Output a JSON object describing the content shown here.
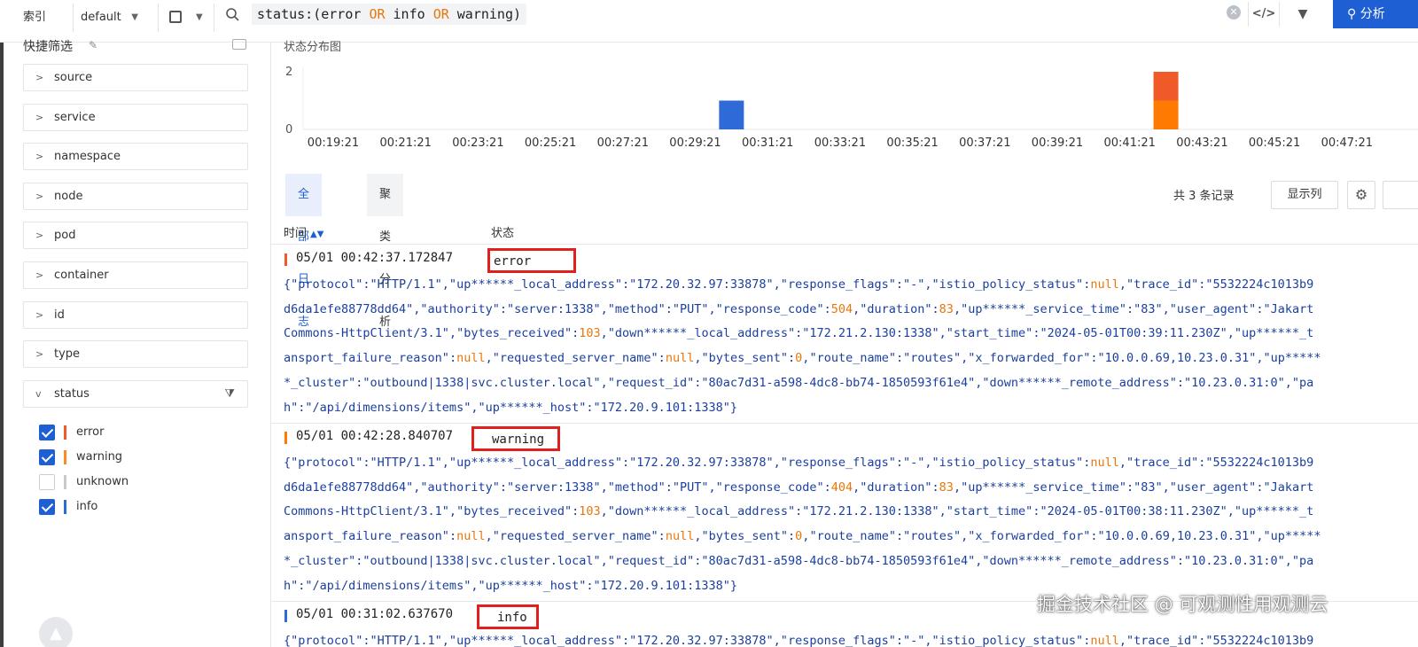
{
  "topbar": {
    "index_label": "索引",
    "index_value": "default",
    "query_prefix": "status:(",
    "query_tokens": [
      "error",
      "OR",
      "info",
      "OR",
      "warning"
    ],
    "query_suffix": ")",
    "analyze_label": "分析"
  },
  "sidebar": {
    "title": "快捷筛选",
    "fields": [
      "source",
      "service",
      "namespace",
      "node",
      "pod",
      "container",
      "id",
      "type"
    ],
    "status_field": "status",
    "status_options": [
      {
        "label": "error",
        "checked": true,
        "color": "#f05a28"
      },
      {
        "label": "warning",
        "checked": true,
        "color": "#ff8a1f"
      },
      {
        "label": "unknown",
        "checked": false,
        "color": "#c7cbd1"
      },
      {
        "label": "info",
        "checked": true,
        "color": "#2f6ad9"
      }
    ]
  },
  "chart_data": {
    "type": "bar",
    "title": "状态分布图",
    "categories": [
      "00:19:21",
      "00:21:21",
      "00:23:21",
      "00:25:21",
      "00:27:21",
      "00:29:21",
      "00:31:21",
      "00:33:21",
      "00:35:21",
      "00:37:21",
      "00:39:21",
      "00:41:21",
      "00:43:21",
      "00:45:21",
      "00:47:21"
    ],
    "y_ticks": [
      0,
      2
    ],
    "ylim": [
      0,
      2
    ],
    "stacked_bars": [
      {
        "x": "00:30:21",
        "segments": [
          {
            "status": "info",
            "value": 1,
            "color": "#2f6ad9"
          }
        ]
      },
      {
        "x": "00:42:21",
        "segments": [
          {
            "status": "warning",
            "value": 1,
            "color": "#ff7a00"
          },
          {
            "status": "error",
            "value": 1,
            "color": "#f05a28"
          }
        ]
      }
    ]
  },
  "tabs": [
    {
      "label": "全部日志",
      "active": true
    },
    {
      "label": "聚类分析",
      "active": false
    }
  ],
  "toolbar": {
    "count_text": "共 3 条记录",
    "columns_label": "显示列"
  },
  "table": {
    "col_time": "时间",
    "col_status": "状态"
  },
  "logs": [
    {
      "time": "05/01 00:42:37.172847",
      "status": "error",
      "bar_color": "#f05a28",
      "lines": [
        "{\"protocol\":\"HTTP/1.1\",\"up******_local_address\":\"172.20.32.97:33878\",\"response_flags\":\"-\",\"istio_policy_status\":null,\"trace_id\":\"5532224c1013b9",
        "d6da1efe88778dd64\",\"authority\":\"server:1338\",\"method\":\"PUT\",\"response_code\":504,\"duration\":83,\"up******_service_time\":\"83\",\"user_agent\":\"Jakart",
        "Commons-HttpClient/3.1\",\"bytes_received\":103,\"down******_local_address\":\"172.21.2.130:1338\",\"start_time\":\"2024-05-01T00:39:11.230Z\",\"up******_t",
        "ansport_failure_reason\":null,\"requested_server_name\":null,\"bytes_sent\":0,\"route_name\":\"routes\",\"x_forwarded_for\":\"10.0.0.69,10.23.0.31\",\"up*****",
        "*_cluster\":\"outbound|1338|svc.cluster.local\",\"request_id\":\"80ac7d31-a598-4dc8-bb74-1850593f61e4\",\"down******_remote_address\":\"10.23.0.31:0\",\"pa",
        "h\":\"/api/dimensions/items\",\"up******_host\":\"172.20.9.101:1338\"}"
      ]
    },
    {
      "time": "05/01 00:42:28.840707",
      "status": "warning",
      "bar_color": "#ff7a00",
      "lines": [
        "{\"protocol\":\"HTTP/1.1\",\"up******_local_address\":\"172.20.32.97:33878\",\"response_flags\":\"-\",\"istio_policy_status\":null,\"trace_id\":\"5532224c1013b9",
        "d6da1efe88778dd64\",\"authority\":\"server:1338\",\"method\":\"PUT\",\"response_code\":404,\"duration\":83,\"up******_service_time\":\"83\",\"user_agent\":\"Jakart",
        "Commons-HttpClient/3.1\",\"bytes_received\":103,\"down******_local_address\":\"172.21.2.130:1338\",\"start_time\":\"2024-05-01T00:38:11.230Z\",\"up******_t",
        "ansport_failure_reason\":null,\"requested_server_name\":null,\"bytes_sent\":0,\"route_name\":\"routes\",\"x_forwarded_for\":\"10.0.0.69,10.23.0.31\",\"up*****",
        "*_cluster\":\"outbound|1338|svc.cluster.local\",\"request_id\":\"80ac7d31-a598-4dc8-bb74-1850593f61e4\",\"down******_remote_address\":\"10.23.0.31:0\",\"pa",
        "h\":\"/api/dimensions/items\",\"up******_host\":\"172.20.9.101:1338\"}"
      ]
    },
    {
      "time": "05/01 00:31:02.637670",
      "status": "info",
      "bar_color": "#2f6ad9",
      "lines": [
        "{\"protocol\":\"HTTP/1.1\",\"up******_local_address\":\"172.20.32.97:33878\",\"response_flags\":\"-\",\"istio_policy_status\":null,\"trace_id\":\"5532224c1013b9"
      ]
    }
  ],
  "footer": {
    "watermark": "掘金技术社区 @ 可观测性用观测云"
  }
}
